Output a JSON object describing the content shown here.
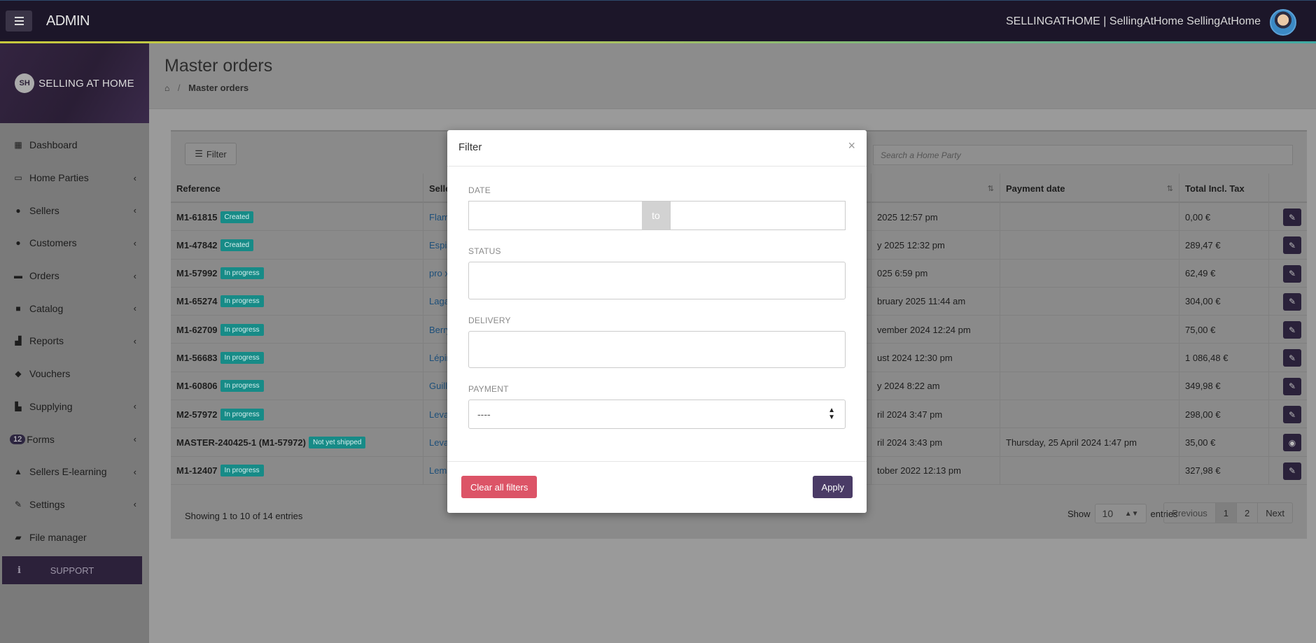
{
  "topbar": {
    "admin_title": "ADMIN",
    "user_name": "SELLINGATHOME | SellingAtHome SellingAtHome"
  },
  "sidebar": {
    "brand_badge": "SH",
    "brand_text": "SELLING AT HOME",
    "items": [
      {
        "label": "Dashboard",
        "icon": "dashboard-icon",
        "chevron": false
      },
      {
        "label": "Home Parties",
        "icon": "calendar-icon",
        "chevron": true
      },
      {
        "label": "Sellers",
        "icon": "users-icon",
        "chevron": true
      },
      {
        "label": "Customers",
        "icon": "users-icon",
        "chevron": true
      },
      {
        "label": "Orders",
        "icon": "credit-card-icon",
        "chevron": true
      },
      {
        "label": "Catalog",
        "icon": "book-icon",
        "chevron": true
      },
      {
        "label": "Reports",
        "icon": "bar-chart-icon",
        "chevron": true
      },
      {
        "label": "Vouchers",
        "icon": "tags-icon",
        "chevron": false
      },
      {
        "label": "Supplying",
        "icon": "industry-icon",
        "chevron": true
      },
      {
        "label": "Forms",
        "icon": "forms-icon",
        "chevron": true,
        "badge": "12"
      },
      {
        "label": "Sellers E-learning",
        "icon": "graduation-cap-icon",
        "chevron": true
      },
      {
        "label": "Settings",
        "icon": "wrench-icon",
        "chevron": true
      },
      {
        "label": "File manager",
        "icon": "folder-open-icon",
        "chevron": false
      }
    ],
    "support_label": "SUPPORT",
    "support_icon": "i"
  },
  "header": {
    "title": "Master orders",
    "breadcrumb_current": "Master orders"
  },
  "toolbar": {
    "filter_label": "Filter",
    "search_placeholder": "Search a Home Party"
  },
  "table": {
    "columns": [
      "Reference",
      "Selle",
      "",
      "Payment date",
      "Total Incl. Tax"
    ],
    "rows": [
      {
        "ref": "M1-61815",
        "status": "Created",
        "seller": "Flam",
        "date": "2025 12:57 pm",
        "payment_date": "",
        "total": "0,00 €",
        "action": "edit"
      },
      {
        "ref": "M1-47842",
        "status": "Created",
        "seller": "Espia",
        "date": "y 2025 12:32 pm",
        "payment_date": "",
        "total": "289,47 €",
        "action": "edit"
      },
      {
        "ref": "M1-57992",
        "status": "In progress",
        "seller": "pro x",
        "date": "025 6:59 pm",
        "payment_date": "",
        "total": "62,49 €",
        "action": "edit"
      },
      {
        "ref": "M1-65274",
        "status": "In progress",
        "seller": "Laga",
        "date": "bruary 2025 11:44 am",
        "payment_date": "",
        "total": "304,00 €",
        "action": "edit"
      },
      {
        "ref": "M1-62709",
        "status": "In progress",
        "seller": "Berry",
        "date": "vember 2024 12:24 pm",
        "payment_date": "",
        "total": "75,00 €",
        "action": "edit"
      },
      {
        "ref": "M1-56683",
        "status": "In progress",
        "seller": "Lépin",
        "date": "ust 2024 12:30 pm",
        "payment_date": "",
        "total": "1 086,48 €",
        "action": "edit"
      },
      {
        "ref": "M1-60806",
        "status": "In progress",
        "seller": "Guill",
        "date": "y 2024 8:22 am",
        "payment_date": "",
        "total": "349,98 €",
        "action": "edit"
      },
      {
        "ref": "M2-57972",
        "status": "In progress",
        "seller": "Leva",
        "date": "ril 2024 3:47 pm",
        "payment_date": "",
        "total": "298,00 €",
        "action": "edit"
      },
      {
        "ref": "MASTER-240425-1 (M1-57972)",
        "status": "Not yet shipped",
        "seller": "Leva",
        "date": "ril 2024 3:43 pm",
        "payment_date": "Thursday, 25 April 2024 1:47 pm",
        "total": "35,00 €",
        "action": "view"
      },
      {
        "ref": "M1-12407",
        "status": "In progress",
        "seller": "Lem",
        "date": "tober 2022 12:13 pm",
        "payment_date": "",
        "total": "327,98 €",
        "action": "edit"
      }
    ],
    "showing_text": "Showing 1 to 10 of 14 entries",
    "show_label": "Show",
    "entries_label": "entries",
    "page_size": "10",
    "pager": [
      "Previous",
      "1",
      "2",
      "Next"
    ]
  },
  "modal": {
    "title": "Filter",
    "close": "×",
    "date_label": "DATE",
    "date_to": "to",
    "status_label": "STATUS",
    "delivery_label": "DELIVERY",
    "payment_label": "PAYMENT",
    "payment_value": "----",
    "clear_label": "Clear all filters",
    "apply_label": "Apply"
  },
  "colors": {
    "topbar": "#1c1629",
    "badge": "#178b87",
    "action": "#2a213a",
    "clear": "#dc5467",
    "apply": "#4a3b66"
  }
}
